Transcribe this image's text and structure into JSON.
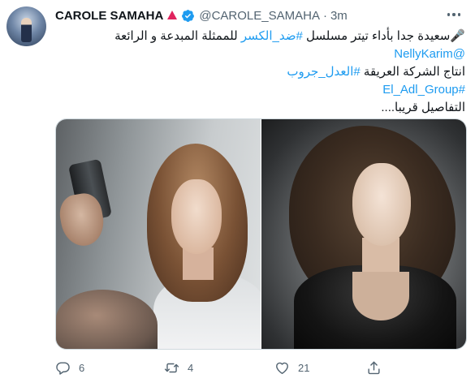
{
  "tweet": {
    "author_name": "CAROLE SAMAHA",
    "handle": "@CAROLE_SAMAHA",
    "separator": "·",
    "time": "3m",
    "body_lines": [
      "🎤سعيدة جدا بأداء تيتر مسلسل #ضد_الكسر للممثلة المبدعة و الرائعة",
      "@NellyKarim",
      "انتاج الشركة العريقة #العدل_جروب",
      "#El_Adl_Group",
      "التفاصيل قريبا...."
    ],
    "inline": {
      "line1_start": "🎤سعيدة جدا بأداء تيتر مسلسل ",
      "line1_tag": "#ضد_الكسر",
      "line1_end": " للممثلة المبدعة و الرائعة",
      "line2_mention": "@NellyKarim",
      "line3_start": "انتاج الشركة العريقة ",
      "line3_tag": "#العدل_جروب",
      "line4_tag": "#El_Adl_Group",
      "line5": "التفاصيل قريبا...."
    }
  },
  "actions": {
    "reply_count": "6",
    "retweet_count": "4",
    "like_count": "21"
  },
  "icons": [
    "avatar",
    "red-triangle-icon",
    "verified-badge-icon",
    "more-options-icon",
    "reply-icon",
    "retweet-icon",
    "like-icon",
    "share-icon"
  ],
  "colors": {
    "link": "#1d9bf0",
    "verified": "#1d9bf0",
    "muted": "#536471",
    "triangle": "#e0245e"
  }
}
